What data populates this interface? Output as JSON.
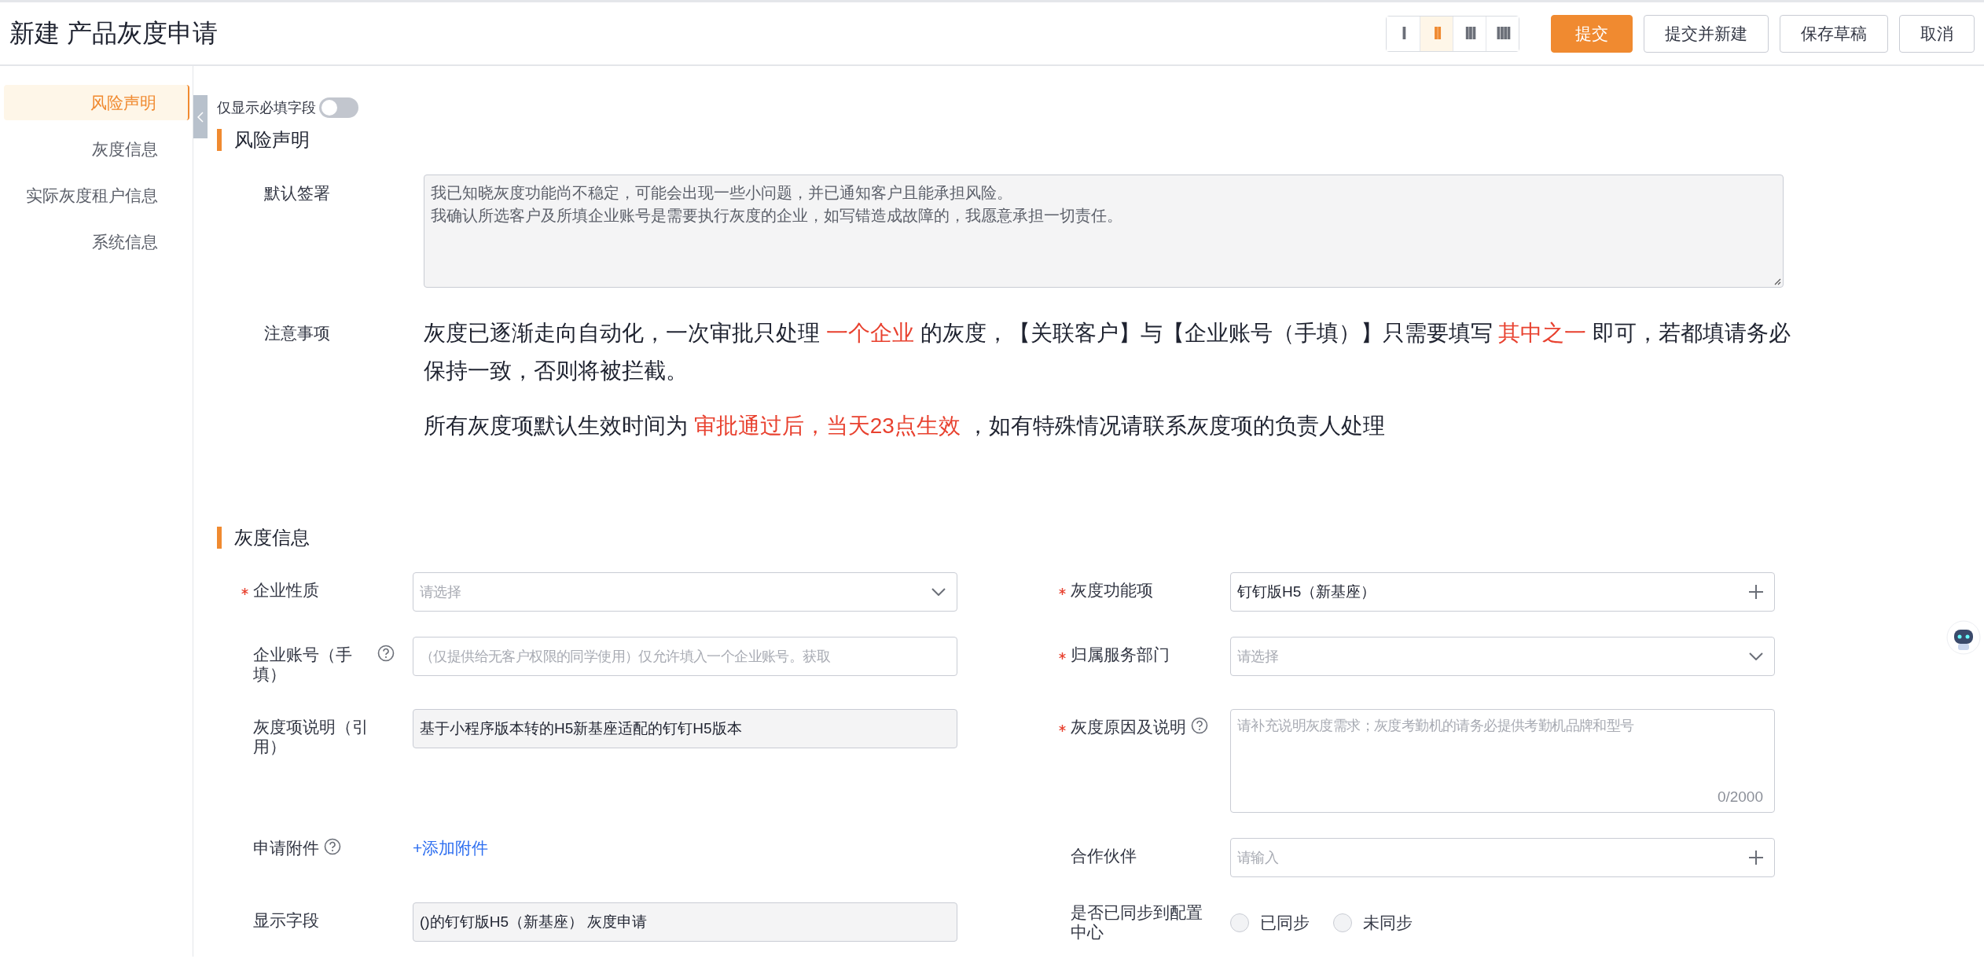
{
  "header": {
    "title": "新建 产品灰度申请",
    "layouts": [
      {
        "label": "I",
        "selected": false
      },
      {
        "label": "II",
        "selected": true
      },
      {
        "label": "III",
        "selected": false
      },
      {
        "label": "IIII",
        "selected": false
      }
    ],
    "buttons": [
      {
        "label": "提交",
        "kind": "primary"
      },
      {
        "label": "提交并新建",
        "kind": "default"
      },
      {
        "label": "保存草稿",
        "kind": "default"
      },
      {
        "label": "取消",
        "kind": "default"
      }
    ]
  },
  "sidebar": {
    "items": [
      {
        "label": "风险声明",
        "selected": true
      },
      {
        "label": "灰度信息",
        "selected": false
      },
      {
        "label": "实际灰度租户信息",
        "selected": false
      },
      {
        "label": "系统信息",
        "selected": false
      }
    ]
  },
  "filter": {
    "label": "仅显示必填字段",
    "on": false
  },
  "risk_section": {
    "title": "风险声明",
    "signature": {
      "label": "默认签署",
      "lines": [
        "我已知晓灰度功能尚不稳定，可能会出现一些小问题，并已通知客户且能承担风险。",
        "我确认所选客户及所填企业账号是需要执行灰度的企业，如写错造成故障的，我愿意承担一切责任。"
      ]
    },
    "notice": {
      "label": "注意事项",
      "paragraphs": [
        [
          {
            "text": "灰度已逐渐走向自动化，一次审批只处理 ",
            "highlight": false
          },
          {
            "text": "一个企业",
            "highlight": true
          },
          {
            "text": " 的灰度，【关联客户】与【企业账号（手填）】只需要填写 ",
            "highlight": false
          },
          {
            "text": "其中之一",
            "highlight": true
          },
          {
            "text": " 即可，若都填请务必保持一致，否则将被拦截。",
            "highlight": false
          }
        ],
        [
          {
            "text": "所有灰度项默认生效时间为 ",
            "highlight": false
          },
          {
            "text": "审批通过后，当天23点生效",
            "highlight": true
          },
          {
            "text": " ，如有特殊情况请联系灰度项的负责人处理",
            "highlight": false
          }
        ]
      ]
    }
  },
  "gray_section": {
    "title": "灰度信息",
    "fields": [
      {
        "kind": "select",
        "label": "企业性质",
        "required": true,
        "placeholder": "请选择"
      },
      {
        "kind": "picker",
        "label": "灰度功能项",
        "required": true,
        "value": "钉钉版H5（新基座）"
      },
      {
        "kind": "input",
        "label": "企业账号（手填）",
        "required": false,
        "help": true,
        "placeholder": "（仅提供给无客户权限的同学使用）仅允许填入一个企业账号。获取"
      },
      {
        "kind": "select",
        "label": "归属服务部门",
        "required": true,
        "placeholder": "请选择"
      },
      {
        "kind": "readonly",
        "label": "灰度项说明（引用）",
        "required": false,
        "value": "基于小程序版本转的H5新基座适配的钉钉H5版本"
      },
      {
        "kind": "textarea",
        "label": "灰度原因及说明",
        "required": true,
        "help": true,
        "placeholder": "请补充说明灰度需求；灰度考勤机的请务必提供考勤机品牌和型号",
        "counter": "0/2000"
      },
      {
        "kind": "attachment",
        "label": "申请附件",
        "required": false,
        "help": true,
        "link": "+添加附件"
      },
      {
        "kind": "picker",
        "label": "合作伙伴",
        "required": false,
        "placeholder": "请输入"
      },
      {
        "kind": "readonly",
        "label": "显示字段",
        "required": false,
        "value": "()的钉钉版H5（新基座） 灰度申请"
      },
      {
        "kind": "radio",
        "label": "是否已同步到配置中心",
        "required": false,
        "options": [
          {
            "label": "已同步",
            "selected": false
          },
          {
            "label": "未同步",
            "selected": false
          }
        ]
      }
    ]
  }
}
